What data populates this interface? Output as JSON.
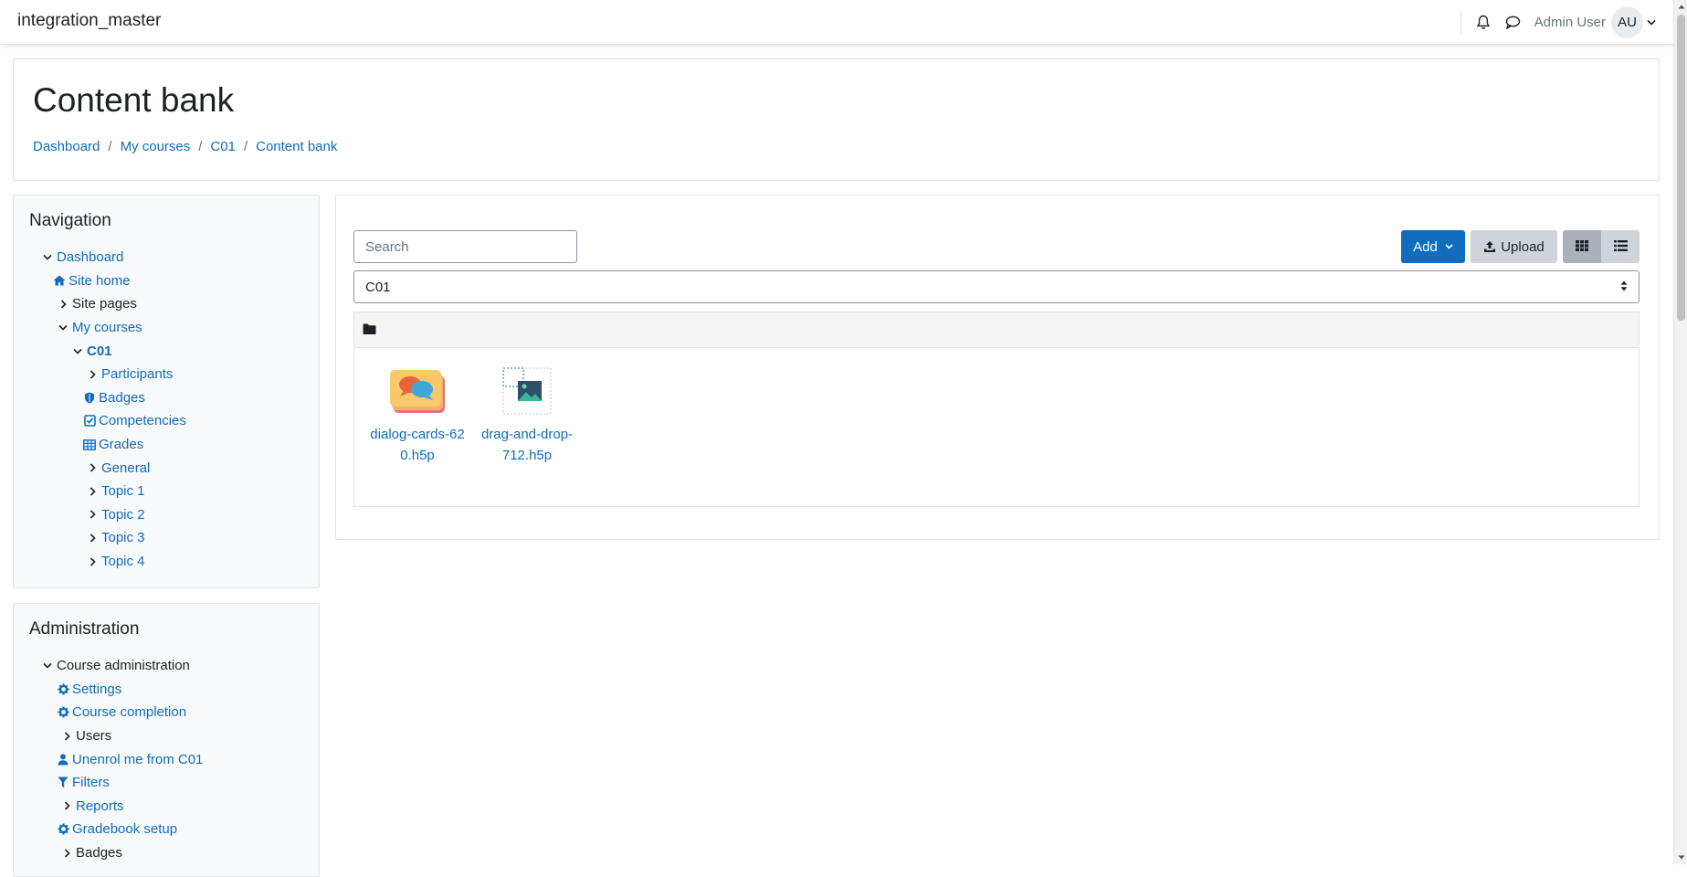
{
  "navbar": {
    "site_name": "integration_master",
    "user_name": "Admin User",
    "user_initials": "AU",
    "icons": [
      "bell-icon",
      "chat-bubble-icon",
      "chevron-down-icon"
    ]
  },
  "header": {
    "title": "Content bank",
    "breadcrumb": [
      "Dashboard",
      "My courses",
      "C01",
      "Content bank"
    ]
  },
  "navigation_block": {
    "title": "Navigation",
    "items": [
      {
        "label": "Dashboard",
        "icon": "chevron-down-icon"
      },
      {
        "label": "Site home",
        "icon": "home-icon"
      },
      {
        "label": "Site pages",
        "icon": "chevron-right-icon"
      },
      {
        "label": "My courses",
        "icon": "chevron-down-icon"
      },
      {
        "label": "C01",
        "icon": "chevron-down-icon"
      },
      {
        "label": "Participants",
        "icon": "chevron-right-icon"
      },
      {
        "label": "Badges",
        "icon": "shield-icon"
      },
      {
        "label": "Competencies",
        "icon": "checkbox-icon"
      },
      {
        "label": "Grades",
        "icon": "table-icon"
      },
      {
        "label": "General",
        "icon": "chevron-right-icon"
      },
      {
        "label": "Topic 1",
        "icon": "chevron-right-icon"
      },
      {
        "label": "Topic 2",
        "icon": "chevron-right-icon"
      },
      {
        "label": "Topic 3",
        "icon": "chevron-right-icon"
      },
      {
        "label": "Topic 4",
        "icon": "chevron-right-icon"
      }
    ]
  },
  "administration_block": {
    "title": "Administration",
    "items": [
      {
        "label": "Course administration",
        "icon": "chevron-down-icon"
      },
      {
        "label": "Settings",
        "icon": "gear-icon"
      },
      {
        "label": "Course completion",
        "icon": "gear-icon"
      },
      {
        "label": "Users",
        "icon": "chevron-right-icon"
      },
      {
        "label": "Unenrol me from C01",
        "icon": "user-icon"
      },
      {
        "label": "Filters",
        "icon": "filter-icon"
      },
      {
        "label": "Reports",
        "icon": "chevron-right-icon"
      },
      {
        "label": "Gradebook setup",
        "icon": "gear-icon"
      },
      {
        "label": "Badges",
        "icon": "chevron-right-icon"
      }
    ]
  },
  "content": {
    "search_placeholder": "Search",
    "add_label": "Add",
    "upload_label": "Upload",
    "context_value": "C01",
    "files": [
      {
        "name": "dialog-cards-620.h5p",
        "icon": "dialog-cards-icon"
      },
      {
        "name": "drag-and-drop-712.h5p",
        "icon": "drag-and-drop-icon"
      }
    ]
  },
  "colors": {
    "link": "#0f6cbf",
    "primary_button": "#0f6cbf",
    "secondary_button": "#ced4da",
    "block_background": "#f8f9fa",
    "border": "#dee2e6"
  }
}
